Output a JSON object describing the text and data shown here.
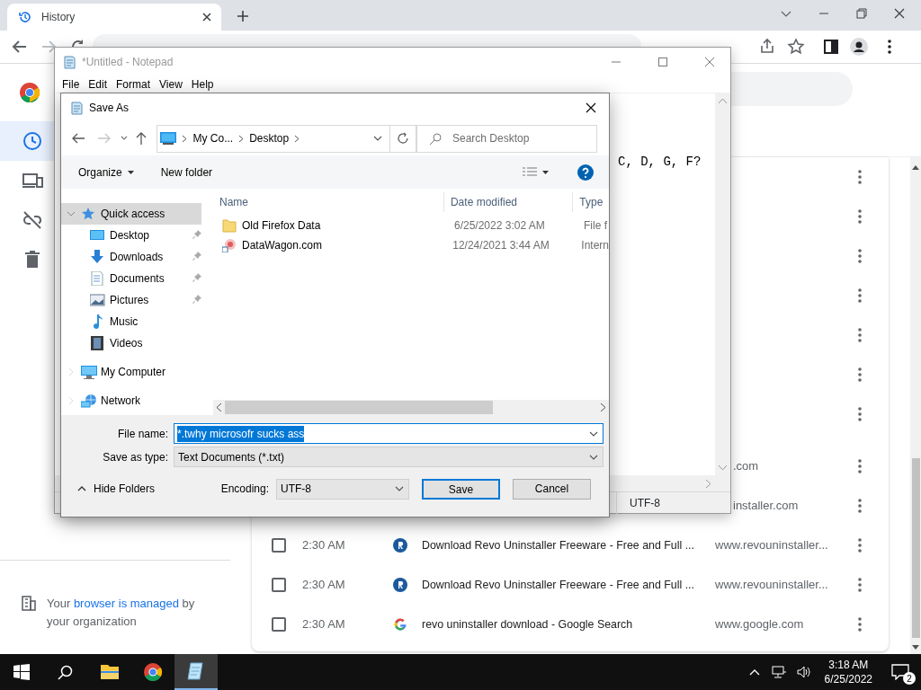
{
  "browser": {
    "tab": {
      "title": "History"
    }
  },
  "history_page": {
    "sidebar": {
      "items": [
        {
          "kind": "history",
          "selected": true
        },
        {
          "kind": "devices",
          "selected": false
        },
        {
          "kind": "unlinked",
          "selected": false
        },
        {
          "kind": "trash",
          "selected": false
        }
      ]
    },
    "managed_notice": {
      "before": "Your ",
      "link": "browser is managed",
      "after": " by your organization"
    },
    "rows": [
      {
        "url": ".com"
      },
      {
        "url": "installer.com"
      },
      {
        "checked": false,
        "time": "2:30 AM",
        "kind": "revo",
        "title": "Download Revo Uninstaller Freeware - Free and Full ...",
        "url": "www.revouninstaller..."
      },
      {
        "checked": false,
        "time": "2:30 AM",
        "kind": "revo",
        "title": "Download Revo Uninstaller Freeware - Free and Full ...",
        "url": "www.revouninstaller..."
      },
      {
        "checked": false,
        "time": "2:30 AM",
        "kind": "google",
        "title": "revo uninstaller download - Google Search",
        "url": "www.google.com"
      }
    ]
  },
  "notepad": {
    "title": "*Untitled - Notepad",
    "menu": [
      "File",
      "Edit",
      "Format",
      "View",
      "Help"
    ],
    "text": "C, D, G, F?",
    "encoding": "UTF-8"
  },
  "save_dialog": {
    "title": "Save As",
    "breadcrumb": [
      "My Co...",
      "Desktop"
    ],
    "search": {
      "placeholder": "Search Desktop"
    },
    "toolbar": {
      "organize": "Organize",
      "new_folder": "New folder"
    },
    "nav": [
      {
        "label": "Quick access",
        "kind": "star",
        "selected": true,
        "expanded": true,
        "children": [
          {
            "label": "Desktop",
            "kind": "desktop",
            "selected": false,
            "pinned": true
          },
          {
            "label": "Downloads",
            "kind": "downloads",
            "selected": false,
            "pinned": true
          },
          {
            "label": "Documents",
            "kind": "documents",
            "selected": false,
            "pinned": true
          },
          {
            "label": "Pictures",
            "kind": "pictures",
            "selected": false,
            "pinned": true
          },
          {
            "label": "Music",
            "kind": "music",
            "selected": false,
            "pinned": false
          },
          {
            "label": "Videos",
            "kind": "videos",
            "selected": false,
            "pinned": false
          }
        ]
      },
      {
        "label": "My Computer",
        "kind": "computer",
        "selected": false,
        "expanded": false
      },
      {
        "label": "Network",
        "kind": "network",
        "selected": false,
        "expanded": false
      }
    ],
    "columns": [
      "Name",
      "Date modified",
      "Type"
    ],
    "files": [
      {
        "name": "Old Firefox Data",
        "kind": "folder",
        "date": "6/25/2022 3:02 AM",
        "type": "File f"
      },
      {
        "name": "DataWagon.com",
        "kind": "shortcut",
        "date": "12/24/2021 3:44 AM",
        "type": "Intern"
      }
    ],
    "file_name": {
      "label": "File name:",
      "value": "*.twhy microsofr sucks ass",
      "selected": true
    },
    "save_type": {
      "label": "Save as type:",
      "value": "Text Documents (*.txt)"
    },
    "hide_folders": "Hide Folders",
    "encoding": {
      "label": "Encoding:",
      "value": "UTF-8"
    },
    "buttons": [
      {
        "label": "Save",
        "default": true
      },
      {
        "label": "Cancel",
        "default": false
      }
    ]
  },
  "taskbar": {
    "apps": [
      {
        "kind": "explorer",
        "active": false
      },
      {
        "kind": "chrome",
        "active": false
      },
      {
        "kind": "notepad",
        "active": true
      }
    ],
    "time": "3:18 AM",
    "date": "6/25/2022",
    "notifications": "2"
  }
}
